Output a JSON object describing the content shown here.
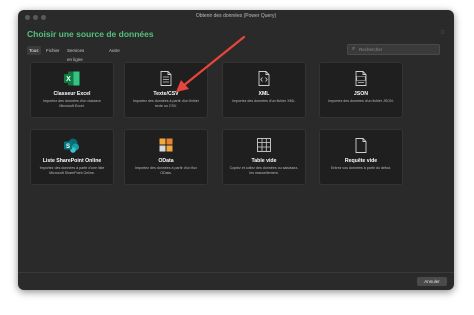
{
  "window": {
    "title": "Obtenir des données (Power Query)"
  },
  "heading": "Choisir une source de données",
  "tabs": [
    "Tous",
    "Fichier",
    "Services en ligne",
    "Autre"
  ],
  "search": {
    "placeholder": "Rechercher"
  },
  "cards": [
    {
      "title": "Classeur Excel",
      "desc": "Importez des données d'un classeur Microsoft Excel.",
      "icon": "excel-icon"
    },
    {
      "title": "Texte/CSV",
      "desc": "Importez des données à partir d'un fichier texte ou CSV.",
      "icon": "text-file-icon"
    },
    {
      "title": "XML",
      "desc": "Importez des données d'un fichier XML.",
      "icon": "xml-file-icon"
    },
    {
      "title": "JSON",
      "desc": "Importez des données d'un fichier JSON.",
      "icon": "json-file-icon"
    },
    {
      "title": "Liste SharePoint Online",
      "desc": "Importez des données à partir d'une liste Microsoft SharePoint Online.",
      "icon": "sharepoint-icon"
    },
    {
      "title": "OData",
      "desc": "Importez des données à partir d'un flux OData.",
      "icon": "odata-icon"
    },
    {
      "title": "Table vide",
      "desc": "Copiez et collez des données ou saisissez-les manuellement.",
      "icon": "table-icon"
    },
    {
      "title": "Requête vide",
      "desc": "Entrez vos données à partir du début.",
      "icon": "blank-query-icon"
    }
  ],
  "footer": {
    "cancel_label": "Annuler"
  },
  "colors": {
    "accent": "#53c27a",
    "annotation_arrow": "#e8453c"
  }
}
